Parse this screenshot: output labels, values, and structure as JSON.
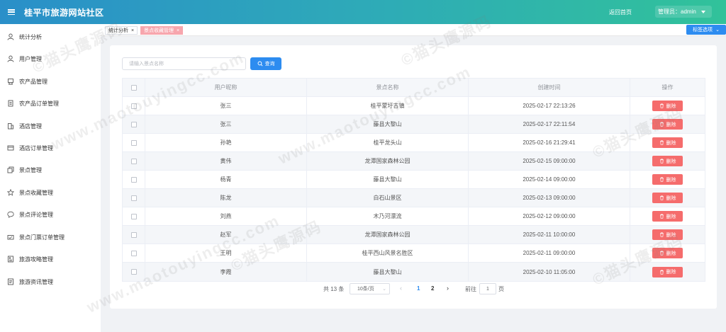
{
  "header": {
    "title": "桂平市旅游网站社区",
    "home_link": "返回首页",
    "admin_label": "管理员：admin"
  },
  "sidebar": {
    "items": [
      {
        "label": "统计分析",
        "icon": "user-icon"
      },
      {
        "label": "用户管理",
        "icon": "user-icon"
      },
      {
        "label": "农产品管理",
        "icon": "product-icon"
      },
      {
        "label": "农产品订单管理",
        "icon": "order-icon"
      },
      {
        "label": "酒店管理",
        "icon": "building-icon"
      },
      {
        "label": "酒店订单管理",
        "icon": "card-icon"
      },
      {
        "label": "景点管理",
        "icon": "copy-icon"
      },
      {
        "label": "景点收藏管理",
        "icon": "star-icon"
      },
      {
        "label": "景点评论管理",
        "icon": "comment-icon"
      },
      {
        "label": "景点门票订单管理",
        "icon": "ticket-icon"
      },
      {
        "label": "旅游攻略管理",
        "icon": "news-icon"
      },
      {
        "label": "旅游资讯管理",
        "icon": "document-icon"
      }
    ]
  },
  "tabs": {
    "items": [
      {
        "label": "统计分析",
        "close": "×"
      },
      {
        "label": "景点收藏管理",
        "close": "×"
      }
    ],
    "options_label": "标签选项"
  },
  "search": {
    "placeholder": "请输入景点名称",
    "button_label": "查询"
  },
  "table": {
    "headers": [
      "用户昵称",
      "景点名称",
      "创建时间",
      "操作"
    ],
    "delete_label": "删除",
    "rows": [
      {
        "user": "张三",
        "spot": "桂平蒙圩古镇",
        "time": "2025-02-17 22:13:26"
      },
      {
        "user": "张三",
        "spot": "藤县大黎山",
        "time": "2025-02-17 22:11:54"
      },
      {
        "user": "孙艳",
        "spot": "桂平龙头山",
        "time": "2025-02-16 21:29:41"
      },
      {
        "user": "黄伟",
        "spot": "龙潭国家森林公园",
        "time": "2025-02-15 09:00:00"
      },
      {
        "user": "杨青",
        "spot": "藤县大黎山",
        "time": "2025-02-14 09:00:00"
      },
      {
        "user": "陈龙",
        "spot": "白石山景区",
        "time": "2025-02-13 09:00:00"
      },
      {
        "user": "刘燕",
        "spot": "木乃河漂流",
        "time": "2025-02-12 09:00:00"
      },
      {
        "user": "赵军",
        "spot": "龙潭国家森林公园",
        "time": "2025-02-11 10:00:00"
      },
      {
        "user": "王明",
        "spot": "桂平西山风景名胜区",
        "time": "2025-02-11 09:00:00"
      },
      {
        "user": "李霞",
        "spot": "藤县大黎山",
        "time": "2025-02-10 11:05:00"
      }
    ]
  },
  "pagination": {
    "total_label": "共 13 条",
    "page_size": "10条/页",
    "prev": "‹",
    "pages": [
      "1",
      "2"
    ],
    "current_page": "1",
    "next": "›",
    "goto_label": "前往",
    "goto_value": "1",
    "page_suffix": "页"
  },
  "watermark": {
    "text1": "©猫头鹰源码",
    "text2": "www.maotouyingcc.com"
  },
  "colors": {
    "header_start": "#2a8fc9",
    "header_end": "#31c29a",
    "primary": "#2d8cf0",
    "danger": "#f56c6c",
    "active_tab": "#f7a6ad"
  }
}
